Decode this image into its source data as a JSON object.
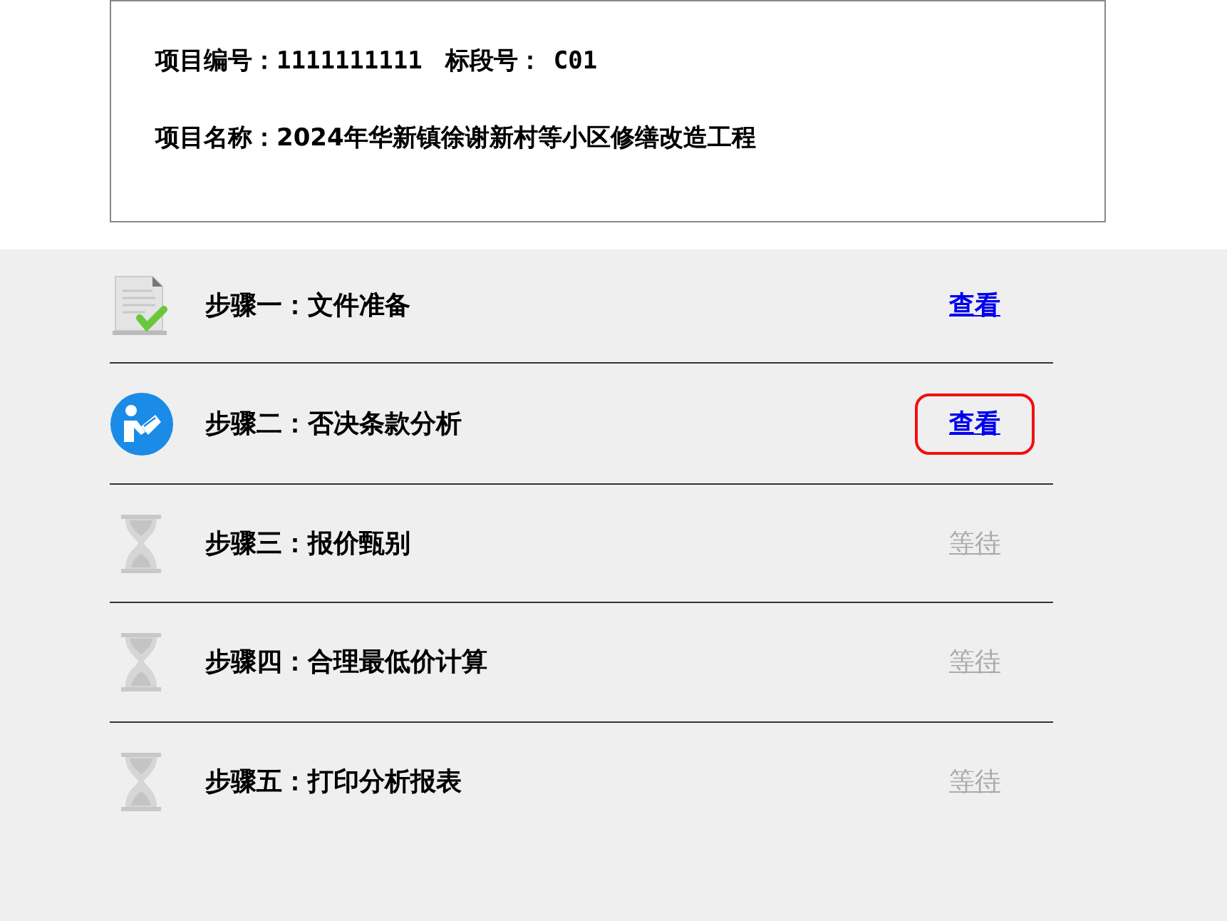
{
  "project": {
    "number_label": "项目编号：",
    "number": "1111111111",
    "section_label": "标段号：",
    "section": "C01",
    "name_label": "项目名称：",
    "name": "2024年华新镇徐谢新村等小区修缮改造工程"
  },
  "steps": [
    {
      "kind": "done",
      "label": "步骤一：文件准备",
      "action": "查看",
      "disabled": false,
      "highlighted": false
    },
    {
      "kind": "current",
      "label": "步骤二：否决条款分析",
      "action": "查看",
      "disabled": false,
      "highlighted": true
    },
    {
      "kind": "waiting",
      "label": "步骤三：报价甄别",
      "action": "等待",
      "disabled": true,
      "highlighted": false
    },
    {
      "kind": "waiting",
      "label": "步骤四：合理最低价计算",
      "action": "等待",
      "disabled": true,
      "highlighted": false
    },
    {
      "kind": "waiting",
      "label": "步骤五：打印分析报表",
      "action": "等待",
      "disabled": true,
      "highlighted": false
    }
  ]
}
